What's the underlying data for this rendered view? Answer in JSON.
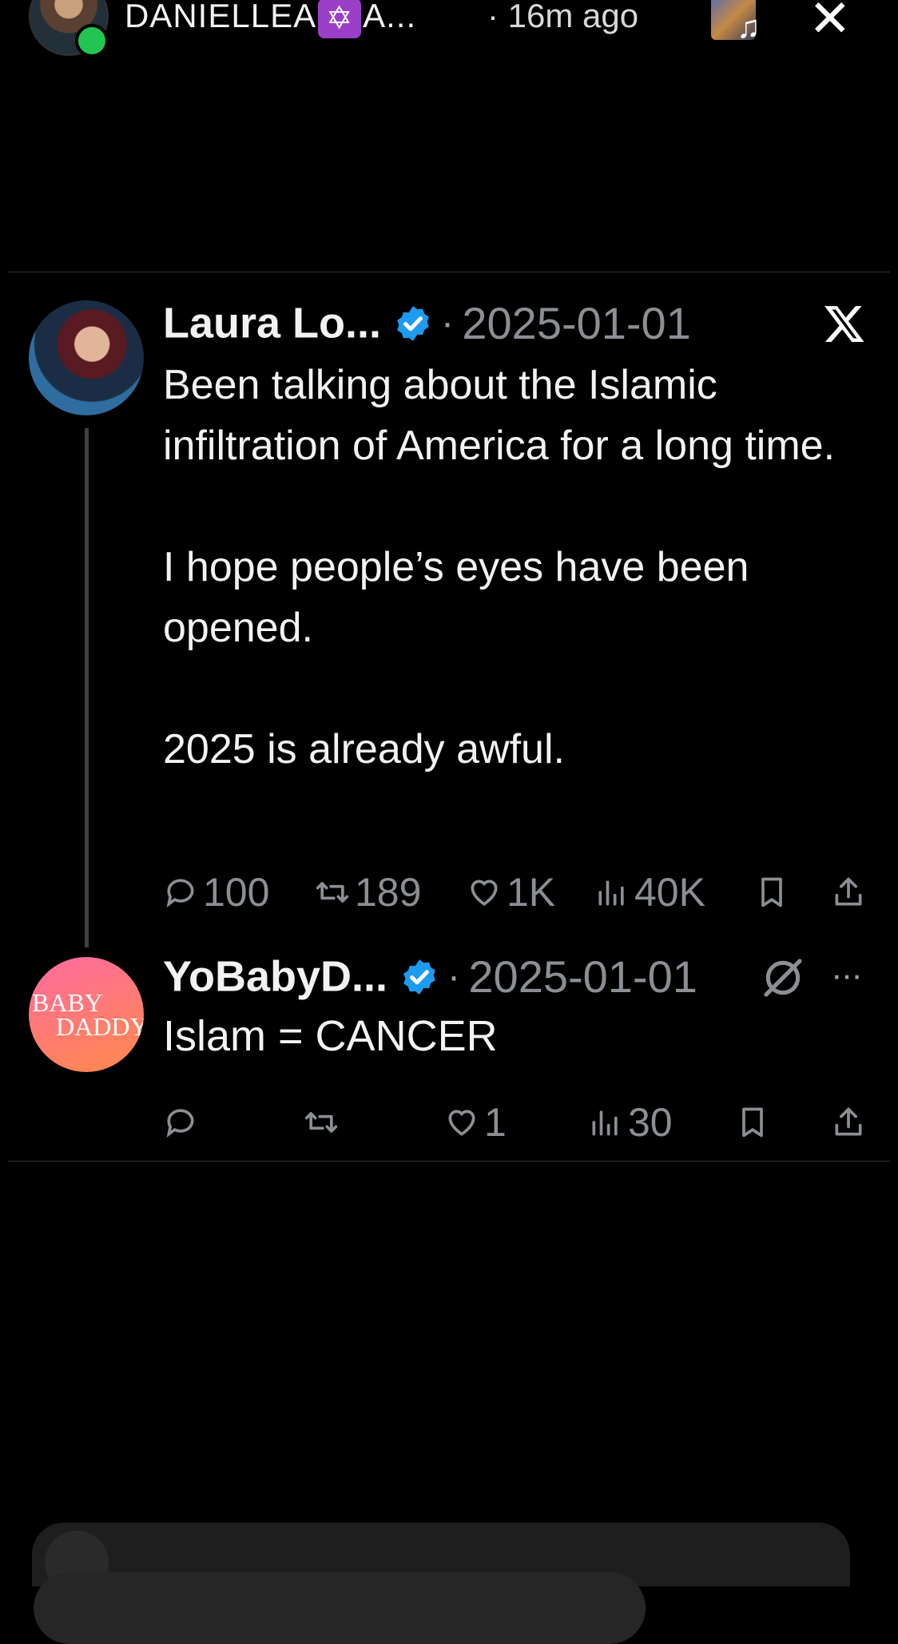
{
  "story": {
    "username_prefix": "DANIELLEA",
    "username_badge": "✡",
    "username_suffix": "A...",
    "time": "· 16m ago",
    "close_label": "✕",
    "music_note": "♫"
  },
  "tweet": {
    "name": "Laura Lo...",
    "dot": "·",
    "date": "2025-01-01",
    "lines": [
      "Been talking about the Islamic infiltration of America for a long time.",
      "I hope people’s eyes have been opened.",
      "2025 is already awful."
    ],
    "replies": "100",
    "reposts": "189",
    "likes": "1K",
    "views": "40K"
  },
  "reply": {
    "name": "YoBabyD...",
    "dot": "·",
    "date": "2025-01-01",
    "text": "Islam = CANCER",
    "likes": "1",
    "views": "30",
    "more": "···",
    "avatar_text_1": "BABY",
    "avatar_text_2": "DADDY"
  },
  "colors": {
    "verified": "#1d9bf0",
    "online": "#23c552",
    "muted": "#8b8f94"
  }
}
